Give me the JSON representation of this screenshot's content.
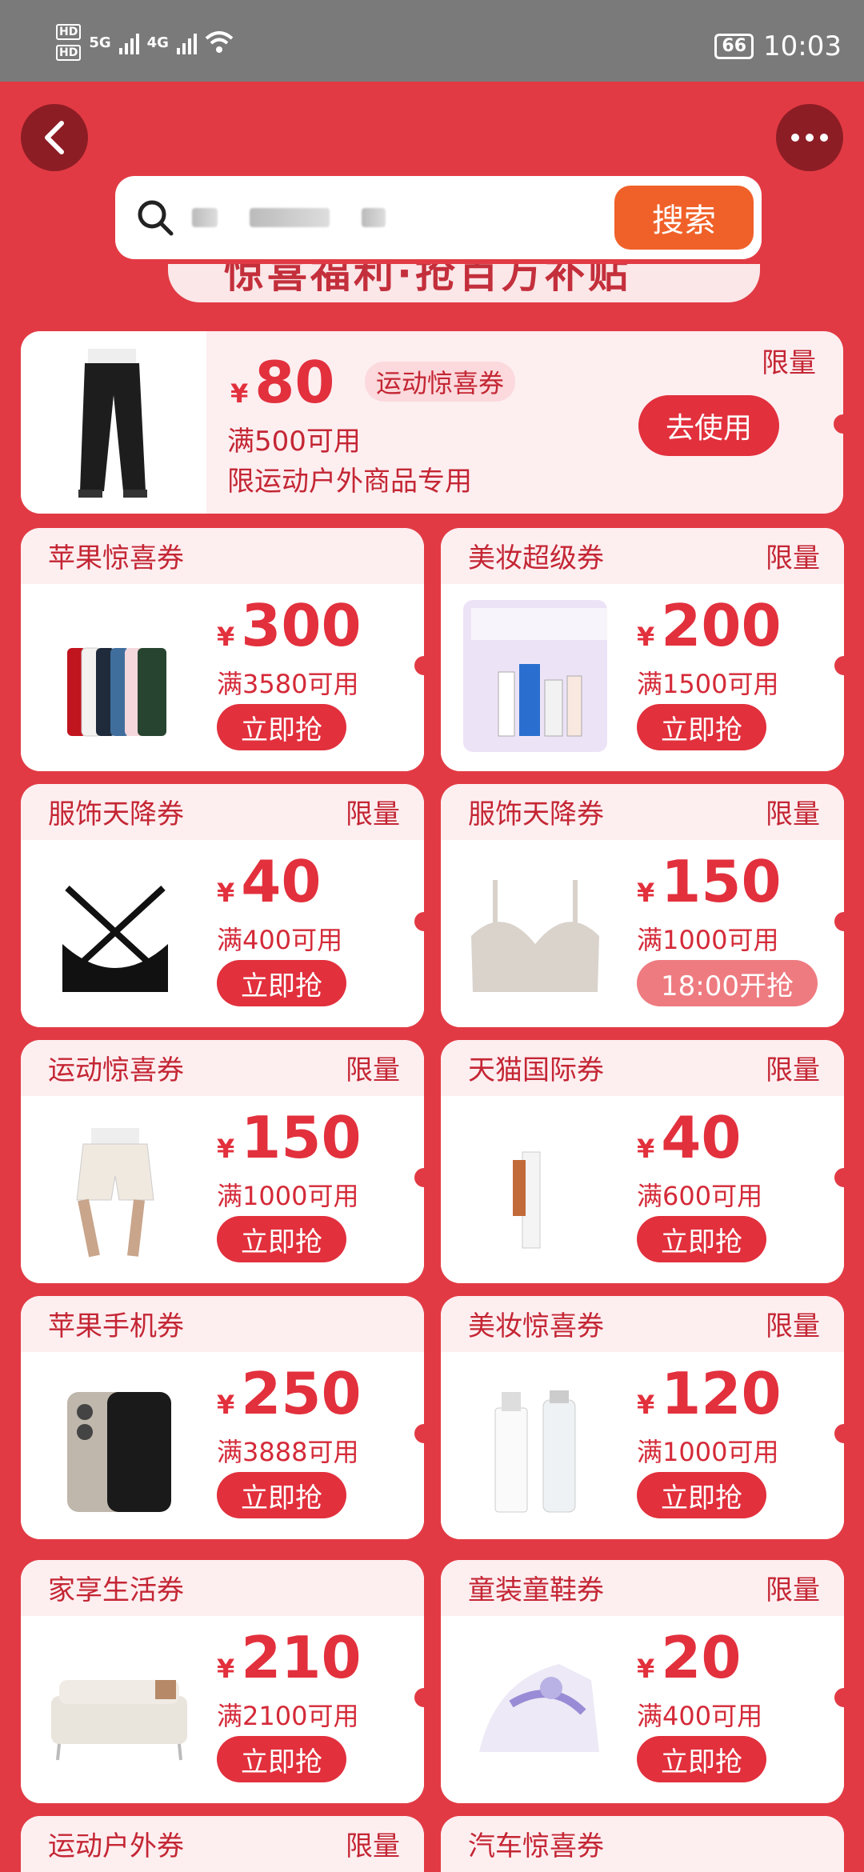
{
  "status_bar": {
    "hd1": "HD",
    "hd2": "HD",
    "net1": "5G",
    "net2": "4G",
    "battery": "66",
    "time": "10:03"
  },
  "search": {
    "button": "搜索"
  },
  "banner_text": "惊喜福利·抢百万补贴",
  "top_coupon": {
    "yen": "¥",
    "amount": "80",
    "tag": "运动惊喜券",
    "condition": "满500可用",
    "scope": "限运动户外商品专用",
    "limited": "限量",
    "button": "去使用"
  },
  "coupons": [
    {
      "title": "苹果惊喜券",
      "limited": "",
      "yen": "¥",
      "amount": "300",
      "condition": "满3580可用",
      "button": "立即抢",
      "product": "iphone-colors"
    },
    {
      "title": "美妆超级券",
      "limited": "限量",
      "yen": "¥",
      "amount": "200",
      "condition": "满1500可用",
      "button": "立即抢",
      "product": "skincare-set"
    },
    {
      "title": "服饰天降券",
      "limited": "限量",
      "yen": "¥",
      "amount": "40",
      "condition": "满400可用",
      "button": "立即抢",
      "product": "black-bra"
    },
    {
      "title": "服饰天降券",
      "limited": "限量",
      "yen": "¥",
      "amount": "150",
      "condition": "满1000可用",
      "button": "18:00开抢",
      "product": "beige-bra"
    },
    {
      "title": "运动惊喜券",
      "limited": "限量",
      "yen": "¥",
      "amount": "150",
      "condition": "满1000可用",
      "button": "立即抢",
      "product": "shorts"
    },
    {
      "title": "天猫国际券",
      "limited": "限量",
      "yen": "¥",
      "amount": "40",
      "condition": "满600可用",
      "button": "立即抢",
      "product": "lip-tube"
    },
    {
      "title": "苹果手机券",
      "limited": "",
      "yen": "¥",
      "amount": "250",
      "condition": "满3888可用",
      "button": "立即抢",
      "product": "iphone-pro"
    },
    {
      "title": "美妆惊喜券",
      "limited": "限量",
      "yen": "¥",
      "amount": "120",
      "condition": "满1000可用",
      "button": "立即抢",
      "product": "lancome-bottles"
    },
    {
      "title": "家享生活券",
      "limited": "",
      "yen": "¥",
      "amount": "210",
      "condition": "满2100可用",
      "button": "立即抢",
      "product": "sofa"
    },
    {
      "title": "童装童鞋券",
      "limited": "限量",
      "yen": "¥",
      "amount": "20",
      "condition": "满400可用",
      "button": "立即抢",
      "product": "sneaker"
    },
    {
      "title": "运动户外券",
      "limited": "限量",
      "yen": "",
      "amount": "",
      "condition": "",
      "button": "",
      "product": ""
    },
    {
      "title": "汽车惊喜券",
      "limited": "",
      "yen": "",
      "amount": "",
      "condition": "",
      "button": "",
      "product": ""
    }
  ]
}
